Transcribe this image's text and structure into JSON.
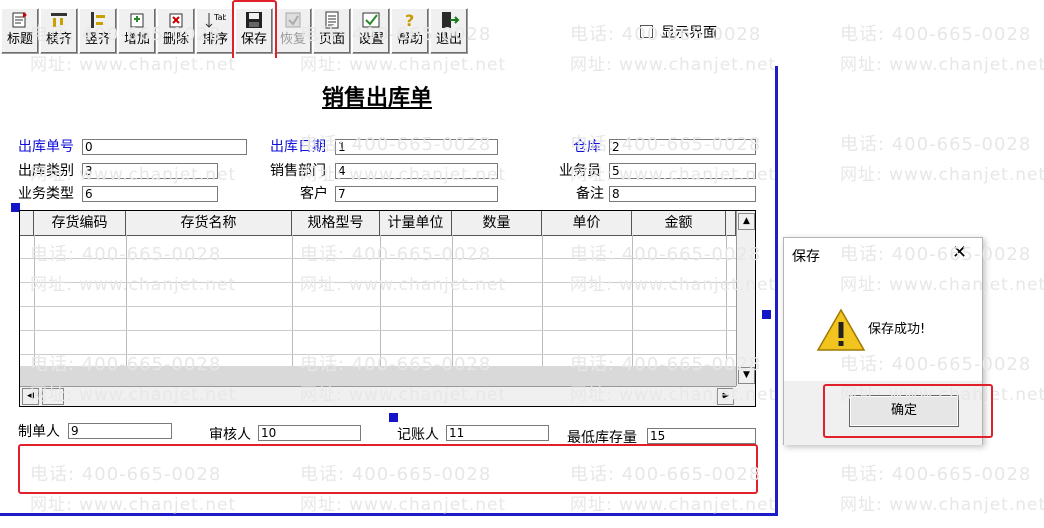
{
  "toolbar": {
    "buttons": [
      {
        "label": "标题",
        "icon": "title-icon",
        "enabled": true
      },
      {
        "label": "横齐",
        "icon": "align-horizontal-icon",
        "enabled": true
      },
      {
        "label": "竖齐",
        "icon": "align-vertical-icon",
        "enabled": true
      },
      {
        "label": "增加",
        "icon": "add-icon",
        "enabled": true
      },
      {
        "label": "删除",
        "icon": "delete-icon",
        "enabled": true
      },
      {
        "label": "排序",
        "icon": "sort-icon",
        "enabled": true
      },
      {
        "label": "保存",
        "icon": "floppy-disk-icon",
        "enabled": true
      },
      {
        "label": "恢复",
        "icon": "restore-icon",
        "enabled": false
      },
      {
        "label": "页面",
        "icon": "page-icon",
        "enabled": true
      },
      {
        "label": "设置",
        "icon": "settings-icon",
        "enabled": true
      },
      {
        "label": "帮助",
        "icon": "help-icon",
        "enabled": true
      },
      {
        "label": "退出",
        "icon": "exit-icon",
        "enabled": true
      }
    ],
    "show_interface_label": "显示界面",
    "show_interface_checked": false
  },
  "document": {
    "title": "销售出库单",
    "fields": {
      "out_no": {
        "label": "出库单号",
        "value": "0"
      },
      "out_date": {
        "label": "出库日期",
        "value": "1"
      },
      "warehouse": {
        "label": "仓库",
        "value": "2"
      },
      "out_category": {
        "label": "出库类别",
        "value": "3"
      },
      "sales_dept": {
        "label": "销售部门",
        "value": "4"
      },
      "salesperson": {
        "label": "业务员",
        "value": "5"
      },
      "biz_type": {
        "label": "业务类型",
        "value": "6"
      },
      "customer": {
        "label": "客户",
        "value": "7"
      },
      "remark": {
        "label": "备注",
        "value": "8"
      }
    },
    "grid": {
      "columns": [
        "存货编码",
        "存货名称",
        "规格型号",
        "计量单位",
        "数量",
        "单价",
        "金额"
      ]
    },
    "footer": {
      "maker": {
        "label": "制单人",
        "value": "9"
      },
      "reviewer": {
        "label": "审核人",
        "value": "10"
      },
      "bookkeeper": {
        "label": "记账人",
        "value": "11"
      },
      "min_stock": {
        "label": "最低库存量",
        "value": "15"
      }
    }
  },
  "dialog": {
    "title": "保存",
    "close": "✕",
    "message": "保存成功!",
    "ok_label": "确定",
    "icon": "warning-icon"
  },
  "watermark": {
    "phone": "电话: 400-665-0028",
    "site": "网址: www.chanjet.net"
  },
  "colors": {
    "label_blue": "#1010d8",
    "highlight_red": "#e0202a",
    "frame_blue": "#1c1cc8"
  }
}
